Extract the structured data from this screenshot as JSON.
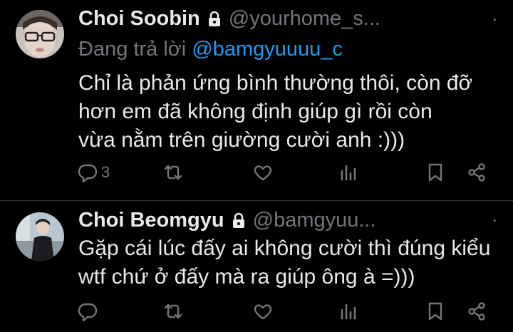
{
  "tweets": [
    {
      "name": "Choi Soobin",
      "handle": "@yourhome_s...",
      "more": "·",
      "replying_prefix": "Đang trả lời ",
      "replying_to": "@bamgyuuuu_c",
      "text": "Chỉ là phản ứng bình thường thôi, còn đỡ\nhơn em đã không định giúp gì rồi còn\nvừa nằm trên giường cười anh :)))",
      "actions": {
        "reply_count": "3",
        "retweet_count": "",
        "like_count": "",
        "view_count": ""
      }
    },
    {
      "name": "Choi Beomgyu",
      "handle": "@bamgyuu...",
      "more": "·",
      "text": "Gặp cái lúc đấy ai không cười thì đúng kiểu\nwtf chứ ở đấy mà ra giúp ông à =)))",
      "actions": {
        "reply_count": "",
        "retweet_count": "",
        "like_count": "",
        "view_count": ""
      }
    }
  ],
  "icons": {
    "reply": "reply-icon",
    "retweet": "retweet-icon",
    "like": "like-icon",
    "views": "views-icon",
    "bookmark": "bookmark-icon",
    "share": "share-icon",
    "lock": "lock-icon",
    "more": "more-icon"
  },
  "colors": {
    "background": "#000000",
    "text": "#e7e9ea",
    "secondary": "#71767b",
    "link": "#1d9bf0"
  }
}
